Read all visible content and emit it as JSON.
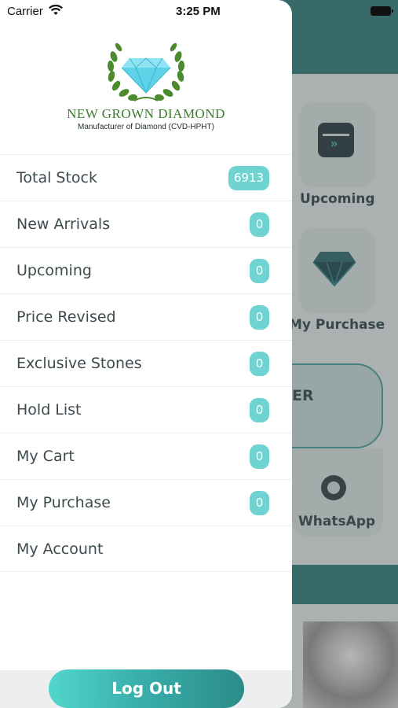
{
  "status_bar": {
    "carrier": "Carrier",
    "time": "3:25 PM"
  },
  "brand": {
    "title": "NEW GROWN DIAMOND",
    "subtitle": "Manufacturer of Diamond (CVD-HPHT)",
    "colors": {
      "title": "#3a7e2a",
      "diamond": "#5ed3e8",
      "laurel": "#4b8a2d"
    }
  },
  "menu": {
    "items": [
      {
        "label": "Total Stock",
        "count": "6913"
      },
      {
        "label": "New Arrivals",
        "count": "0"
      },
      {
        "label": "Upcoming",
        "count": "0"
      },
      {
        "label": "Price Revised",
        "count": "0"
      },
      {
        "label": "Exclusive Stones",
        "count": "0"
      },
      {
        "label": "Hold List",
        "count": "0"
      },
      {
        "label": "My Cart",
        "count": "0"
      },
      {
        "label": "My Purchase",
        "count": "0"
      },
      {
        "label": "My Account"
      }
    ]
  },
  "logout_label": "Log Out",
  "background": {
    "upcoming_label": "Upcoming",
    "purchase_label": "My Purchase",
    "panel_text": "ER",
    "whatsapp_label": "WhatsApp"
  },
  "colors": {
    "accent": "#6fd4d1",
    "primary_dark": "#2e7f7c"
  }
}
